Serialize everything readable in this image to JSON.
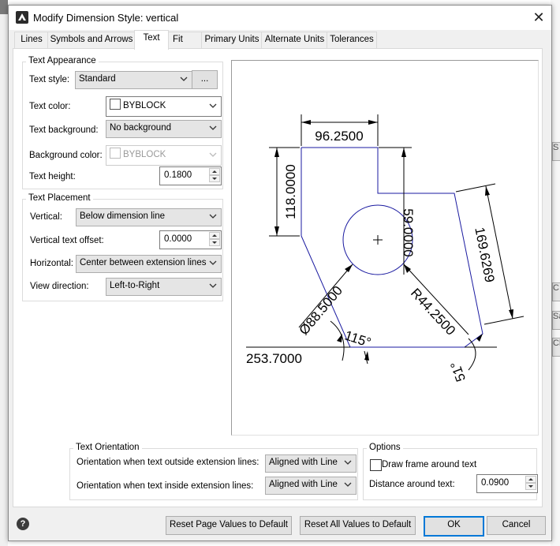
{
  "dialog": {
    "title": "Modify Dimension Style: vertical"
  },
  "tabs": [
    {
      "label": "Lines",
      "active": false
    },
    {
      "label": "Symbols and Arrows",
      "active": false
    },
    {
      "label": "Text",
      "active": true
    },
    {
      "label": "Fit",
      "active": false
    },
    {
      "label": "Primary Units",
      "active": false
    },
    {
      "label": "Alternate Units",
      "active": false
    },
    {
      "label": "Tolerances",
      "active": false
    }
  ],
  "text_appearance": {
    "title": "Text Appearance",
    "text_style_label": "Text style:",
    "text_style_value": "Standard",
    "text_style_button": "...",
    "text_color_label": "Text color:",
    "text_color_value": "BYBLOCK",
    "text_background_label": "Text background:",
    "text_background_value": "No background",
    "background_color_label": "Background color:",
    "background_color_value": "BYBLOCK",
    "text_height_label": "Text height:",
    "text_height_value": "0.1800"
  },
  "text_placement": {
    "title": "Text Placement",
    "vertical_label": "Vertical:",
    "vertical_value": "Below dimension line",
    "offset_label": "Vertical text offset:",
    "offset_value": "0.0000",
    "horizontal_label": "Horizontal:",
    "horizontal_value": "Center between extension lines",
    "view_direction_label": "View direction:",
    "view_direction_value": "Left-to-Right"
  },
  "preview": {
    "dim_top": "96.2500",
    "dim_left": "118.0000",
    "dim_mid": "59.0000",
    "dim_right": "169.6269",
    "dim_diameter": "Ø88.5000",
    "dim_radius": "R44.2500",
    "dim_angle": "115°",
    "dim_bottom": "253.7000",
    "dim_angle_right": "51°"
  },
  "text_orientation": {
    "title": "Text Orientation",
    "outside_label": "Orientation when text outside extension lines:",
    "outside_value": "Aligned with Line",
    "inside_label": "Orientation when text inside extension lines:",
    "inside_value": "Aligned with Line"
  },
  "options": {
    "title": "Options",
    "draw_frame_label": "Draw frame around text",
    "draw_frame_checked": false,
    "distance_label": "Distance around text:",
    "distance_value": "0.0900"
  },
  "footer": {
    "reset_page": "Reset Page Values to Default",
    "reset_all": "Reset All Values to Default",
    "ok": "OK",
    "cancel": "Cancel"
  },
  "background": {
    "items": [
      "S",
      "Sa",
      "Cle",
      "C"
    ]
  },
  "colors": {
    "accent": "#0078d7",
    "geometry": "#1a1aa0"
  }
}
